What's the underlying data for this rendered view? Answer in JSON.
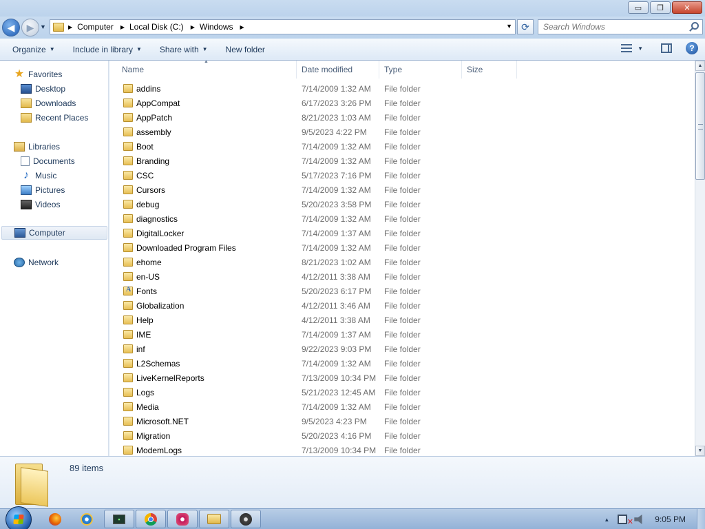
{
  "window": {
    "minimize_glyph": "▭",
    "maximize_glyph": "❐",
    "close_glyph": "✕"
  },
  "address": {
    "crumbs": [
      "Computer",
      "Local Disk (C:)",
      "Windows"
    ],
    "search_placeholder": "Search Windows"
  },
  "toolbar": {
    "organize": "Organize",
    "include_in_library": "Include in library",
    "share_with": "Share with",
    "new_folder": "New folder",
    "help_glyph": "?"
  },
  "nav": {
    "favorites": "Favorites",
    "desktop": "Desktop",
    "downloads": "Downloads",
    "recent_places": "Recent Places",
    "libraries": "Libraries",
    "documents": "Documents",
    "music": "Music",
    "pictures": "Pictures",
    "videos": "Videos",
    "computer": "Computer",
    "network": "Network"
  },
  "columns": {
    "name": "Name",
    "date_modified": "Date modified",
    "type": "Type",
    "size": "Size"
  },
  "files": [
    {
      "name": "addins",
      "date": "7/14/2009 1:32 AM",
      "type": "File folder"
    },
    {
      "name": "AppCompat",
      "date": "6/17/2023 3:26 PM",
      "type": "File folder"
    },
    {
      "name": "AppPatch",
      "date": "8/21/2023 1:03 AM",
      "type": "File folder"
    },
    {
      "name": "assembly",
      "date": "9/5/2023 4:22 PM",
      "type": "File folder"
    },
    {
      "name": "Boot",
      "date": "7/14/2009 1:32 AM",
      "type": "File folder"
    },
    {
      "name": "Branding",
      "date": "7/14/2009 1:32 AM",
      "type": "File folder"
    },
    {
      "name": "CSC",
      "date": "5/17/2023 7:16 PM",
      "type": "File folder"
    },
    {
      "name": "Cursors",
      "date": "7/14/2009 1:32 AM",
      "type": "File folder"
    },
    {
      "name": "debug",
      "date": "5/20/2023 3:58 PM",
      "type": "File folder"
    },
    {
      "name": "diagnostics",
      "date": "7/14/2009 1:32 AM",
      "type": "File folder"
    },
    {
      "name": "DigitalLocker",
      "date": "7/14/2009 1:37 AM",
      "type": "File folder"
    },
    {
      "name": "Downloaded Program Files",
      "date": "7/14/2009 1:32 AM",
      "type": "File folder"
    },
    {
      "name": "ehome",
      "date": "8/21/2023 1:02 AM",
      "type": "File folder"
    },
    {
      "name": "en-US",
      "date": "4/12/2011 3:38 AM",
      "type": "File folder"
    },
    {
      "name": "Fonts",
      "date": "5/20/2023 6:17 PM",
      "type": "File folder"
    },
    {
      "name": "Globalization",
      "date": "4/12/2011 3:46 AM",
      "type": "File folder"
    },
    {
      "name": "Help",
      "date": "4/12/2011 3:38 AM",
      "type": "File folder"
    },
    {
      "name": "IME",
      "date": "7/14/2009 1:37 AM",
      "type": "File folder"
    },
    {
      "name": "inf",
      "date": "9/22/2023 9:03 PM",
      "type": "File folder"
    },
    {
      "name": "L2Schemas",
      "date": "7/14/2009 1:32 AM",
      "type": "File folder"
    },
    {
      "name": "LiveKernelReports",
      "date": "7/13/2009 10:34 PM",
      "type": "File folder"
    },
    {
      "name": "Logs",
      "date": "5/21/2023 12:45 AM",
      "type": "File folder"
    },
    {
      "name": "Media",
      "date": "7/14/2009 1:32 AM",
      "type": "File folder"
    },
    {
      "name": "Microsoft.NET",
      "date": "9/5/2023 4:23 PM",
      "type": "File folder"
    },
    {
      "name": "Migration",
      "date": "5/20/2023 4:16 PM",
      "type": "File folder"
    },
    {
      "name": "ModemLogs",
      "date": "7/13/2009 10:34 PM",
      "type": "File folder"
    }
  ],
  "status": {
    "item_count": "89 items"
  },
  "taskbar": {
    "clock": "9:05 PM",
    "apps": [
      "firefox",
      "internet-explorer",
      "terminal",
      "chrome",
      "settings-app",
      "file-explorer",
      "disk-app"
    ]
  }
}
